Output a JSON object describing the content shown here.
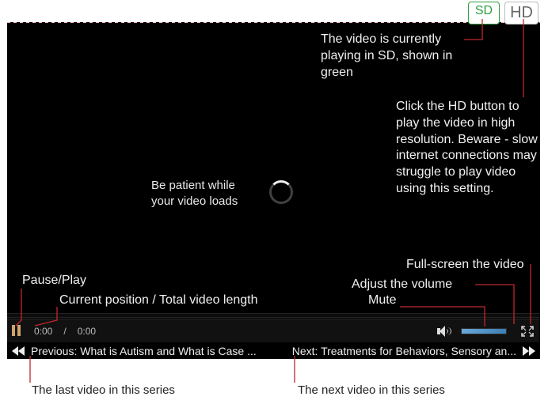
{
  "quality": {
    "sd_label": "SD",
    "hd_label": "HD",
    "sd_annotation": "The video is currently playing in SD, shown in green",
    "hd_annotation": "Click the HD button to play the video in high resolution. Beware - slow internet connections may struggle to play video using this setting."
  },
  "loading": {
    "line1": "Be patient while",
    "line2": "your video loads"
  },
  "controls": {
    "pause_play_label": "Pause/Play",
    "position_label": "Current position / Total video length",
    "current_time": "0:00",
    "separator": "/",
    "total_time": "0:00",
    "mute_label": "Mute",
    "volume_label": "Adjust the volume",
    "fullscreen_label": "Full-screen the video"
  },
  "nav": {
    "prev_label": "Previous: What is Autism and What is Case ...",
    "next_label": "Next: Treatments for Behaviors, Sensory an...",
    "prev_annotation": "The last video in this series",
    "next_annotation": "The next video in this series"
  }
}
